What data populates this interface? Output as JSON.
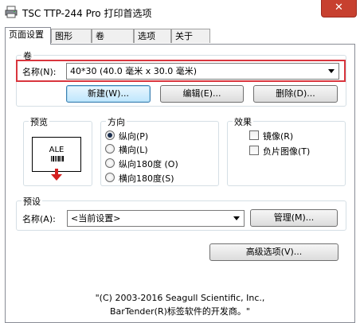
{
  "window": {
    "title": "TSC TTP-244 Pro 打印首选项",
    "close_label": "✕"
  },
  "tabs": [
    {
      "label": "页面设置"
    },
    {
      "label": "图形"
    },
    {
      "label": "卷"
    },
    {
      "label": "选项"
    },
    {
      "label": "关于"
    }
  ],
  "roll": {
    "group_label": "卷",
    "name_label": "名称(N):",
    "name_value": "40*30 (40.0 毫米 x 30.0 毫米)",
    "buttons": {
      "new": "新建(W)...",
      "edit": "编辑(E)...",
      "delete": "删除(D)..."
    }
  },
  "preview": {
    "group_label": "预览",
    "sample_text": "ALE"
  },
  "orientation": {
    "group_label": "方向",
    "options": [
      {
        "label": "纵向(P)",
        "selected": true
      },
      {
        "label": "横向(L)",
        "selected": false
      },
      {
        "label": "纵向180度 (O)",
        "selected": false
      },
      {
        "label": "横向180度(S)",
        "selected": false
      }
    ]
  },
  "effects": {
    "group_label": "效果",
    "options": [
      {
        "label": "镜像(R)",
        "checked": false
      },
      {
        "label": "负片图像(T)",
        "checked": false
      }
    ]
  },
  "presets": {
    "group_label": "预设",
    "name_label": "名称(A):",
    "name_value": "<当前设置>",
    "manage_button": "管理(M)..."
  },
  "advanced_button": "高级选项(V)...",
  "copyright": {
    "line1": "\"(C) 2003-2016 Seagull Scientific, Inc.,",
    "line2": "BarTender(R)标签软件的开发商。\""
  },
  "colors": {
    "highlight": "#d9363e",
    "close_button": "#c7402f",
    "arrow_red": "#d42020"
  }
}
